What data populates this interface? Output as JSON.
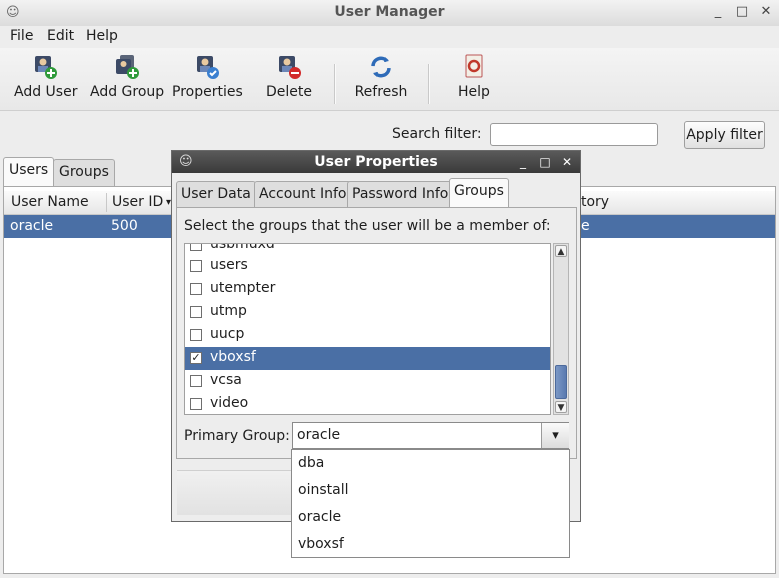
{
  "window": {
    "title": "User Manager"
  },
  "menu": [
    "File",
    "Edit",
    "Help"
  ],
  "toolbar": {
    "add_user": "Add User",
    "add_group": "Add Group",
    "properties": "Properties",
    "delete": "Delete",
    "refresh": "Refresh",
    "help": "Help"
  },
  "search": {
    "label": "Search filter:",
    "value": "",
    "apply": "Apply filter"
  },
  "main_tabs": [
    "Users",
    "Groups"
  ],
  "users_table": {
    "columns": [
      "User Name",
      "User ID",
      "tory"
    ],
    "rows": [
      {
        "name": "oracle",
        "uid": "500",
        "dir": "e"
      }
    ]
  },
  "dialog": {
    "title": "User Properties",
    "tabs": [
      "User Data",
      "Account Info",
      "Password Info",
      "Groups"
    ],
    "active_tab": "Groups",
    "prompt": "Select the groups that the user will be a member of:",
    "groups": [
      {
        "name": "usbmuxd",
        "checked": false
      },
      {
        "name": "users",
        "checked": false
      },
      {
        "name": "utempter",
        "checked": false
      },
      {
        "name": "utmp",
        "checked": false
      },
      {
        "name": "uucp",
        "checked": false
      },
      {
        "name": "vboxsf",
        "checked": true
      },
      {
        "name": "vcsa",
        "checked": false
      },
      {
        "name": "video",
        "checked": false
      }
    ],
    "primary_group_label": "Primary Group:",
    "primary_group_value": "oracle",
    "primary_group_options": [
      "dba",
      "oinstall",
      "oracle",
      "vboxsf"
    ]
  },
  "colors": {
    "selection": "#4a6fa5",
    "dialog_title": "#3a3a3a"
  }
}
